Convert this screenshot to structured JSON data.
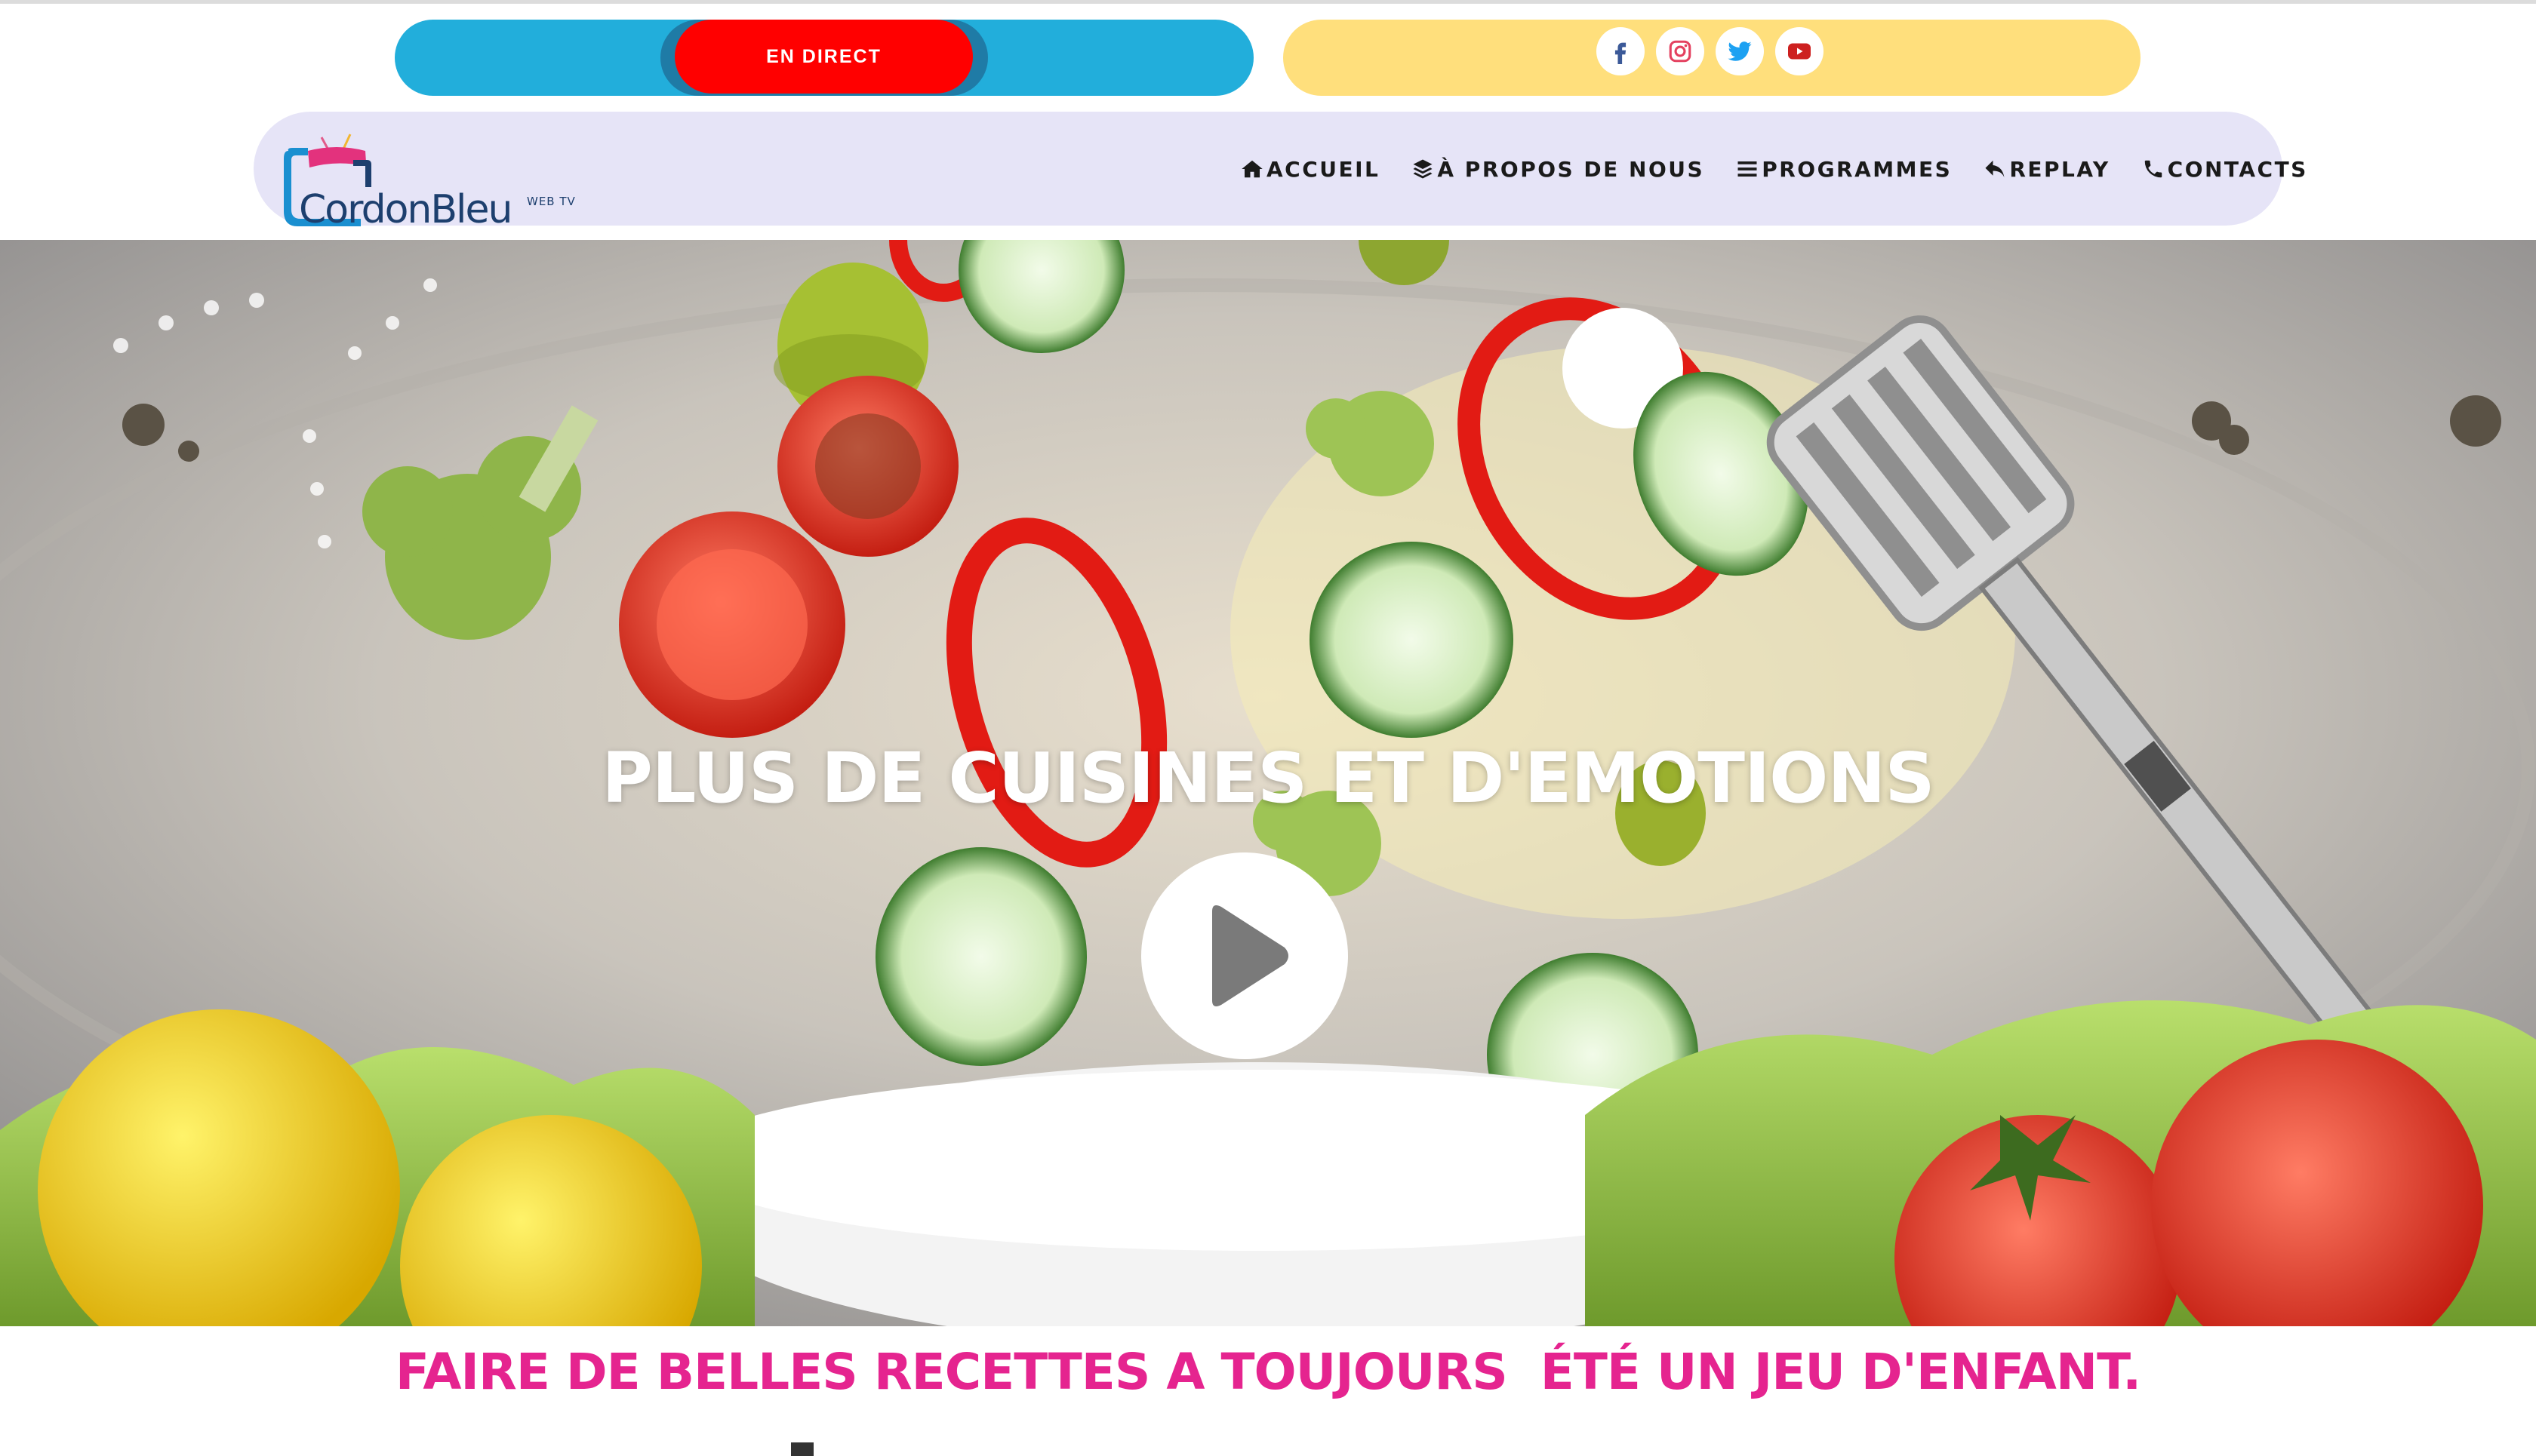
{
  "topbar": {
    "live_label": "EN DIRECT",
    "social": [
      "facebook-icon",
      "instagram-icon",
      "twitter-icon",
      "youtube-icon"
    ]
  },
  "logo": {
    "name": "CordonBleu",
    "sub": "WEB TV"
  },
  "nav": {
    "items": [
      {
        "label": "ACCUEIL",
        "icon": "home-icon"
      },
      {
        "label": "À PROPOS DE NOUS",
        "icon": "layers-icon"
      },
      {
        "label": "PROGRAMMES",
        "icon": "menu-icon"
      },
      {
        "label": "REPLAY",
        "icon": "reply-icon"
      },
      {
        "label": "CONTACTS",
        "icon": "phone-icon"
      }
    ]
  },
  "hero": {
    "title": "PLUS DE CUISINES ET D'EMOTIONS"
  },
  "tagline": "FAIRE DE BELLES RECETTES A TOUJOURS  ÉTÉ UN JEU D'ENFANT.",
  "colors": {
    "live_bar": "#22aedb",
    "live_button": "#ff0000",
    "social_bar": "#ffdf7c",
    "navbar": "#e6e4f7",
    "tagline": "#e5248f"
  }
}
